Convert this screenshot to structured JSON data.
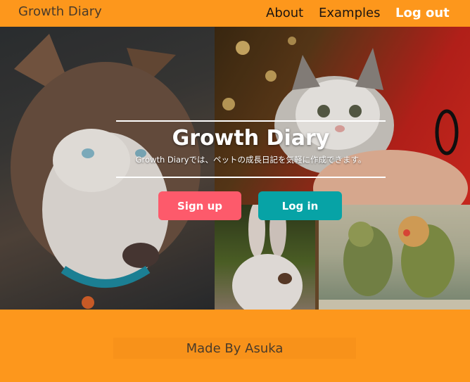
{
  "navbar": {
    "brand": "Growth Diary",
    "links": [
      "About",
      "Examples",
      "Log out"
    ]
  },
  "hero": {
    "title": "Growth Diary",
    "subtitle": "Growth Diaryでは、ペットの成長日記を気軽に作成できます。",
    "signup_label": "Sign up",
    "login_label": "Log in"
  },
  "footer": {
    "text": "Made By Asuka"
  },
  "colors": {
    "accent": "#fd971c",
    "signup": "#fd5a6b",
    "login": "#07a3a6"
  },
  "images": [
    "dog",
    "cat",
    "rabbit",
    "birds"
  ]
}
